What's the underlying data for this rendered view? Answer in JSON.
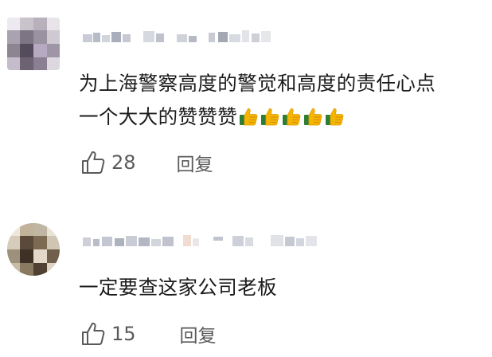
{
  "comments": [
    {
      "text_line1": "为上海警察高度的警觉和高度的责任心点",
      "text_line2": "一个大大的赞赞赞",
      "emoji": [
        "👍",
        "👍",
        "👍",
        "👍",
        "👍"
      ],
      "like_icon": "thumbs-up-outline-icon",
      "likes": "28",
      "reply_label": "回复"
    },
    {
      "text_line1": "一定要查这家公司老板",
      "like_icon": "thumbs-up-outline-icon",
      "likes": "15",
      "reply_label": "回复"
    }
  ]
}
